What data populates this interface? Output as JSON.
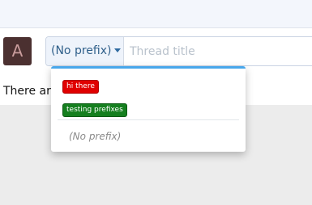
{
  "composer": {
    "avatar_letter": "A",
    "prefix_button_label": "(No prefix)",
    "title_placeholder": "Thread title"
  },
  "notice_text": "There are",
  "prefix_menu": {
    "items": [
      {
        "label": "hi there",
        "color": "#e00000"
      },
      {
        "label": "testing prefixes",
        "color": "#157f1f"
      }
    ],
    "no_prefix_label": "(No prefix)"
  },
  "colors": {
    "accent": "#47a7eb",
    "prefix_text": "#2f5f8a"
  }
}
